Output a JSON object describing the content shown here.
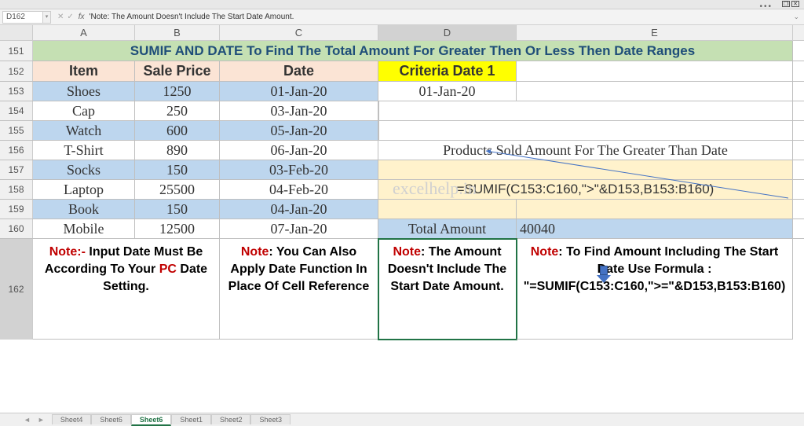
{
  "namebox": "D162",
  "formula_bar": "'Note: The Amount Doesn't Include The Start Date Amount.",
  "columns": [
    "A",
    "B",
    "C",
    "D",
    "E"
  ],
  "title_row": {
    "num": "151",
    "text": "SUMIF AND DATE To Find The Total Amount For Greater Then Or Less Then Date Ranges"
  },
  "header_row": {
    "num": "152",
    "item": "Item",
    "price": "Sale Price",
    "date": "Date",
    "crit": "Criteria Date 1"
  },
  "data_rows": [
    {
      "num": "153",
      "item": "Shoes",
      "price": "1250",
      "date": "01-Jan-20",
      "crit": "01-Jan-20",
      "blue": true
    },
    {
      "num": "154",
      "item": "Cap",
      "price": "250",
      "date": "03-Jan-20",
      "blue": false
    },
    {
      "num": "155",
      "item": "Watch",
      "price": "600",
      "date": "05-Jan-20",
      "blue": true
    },
    {
      "num": "156",
      "item": "T-Shirt",
      "price": "890",
      "date": "06-Jan-20",
      "blue": false,
      "right": "Products Sold Amount For The Greater Than Date"
    },
    {
      "num": "157",
      "item": "Socks",
      "price": "150",
      "date": "03-Feb-20",
      "blue": true
    },
    {
      "num": "158",
      "item": "Laptop",
      "price": "25500",
      "date": "04-Feb-20",
      "blue": false
    },
    {
      "num": "159",
      "item": "Book",
      "price": "150",
      "date": "04-Jan-20",
      "blue": true
    },
    {
      "num": "160",
      "item": "Mobile",
      "price": "12500",
      "date": "07-Jan-20",
      "blue": false
    }
  ],
  "formula_text": "=SUMIF(C153:C160,\">\"&D153,B153:B160)",
  "total_label": "Total Amount",
  "total_value": "40040",
  "notes_row_num": "162",
  "note1": {
    "red": "Note:-",
    "t1": " Input Date Must Be According To Your ",
    "red2": "PC",
    "t2": " Date Setting."
  },
  "note2": {
    "red": "Note",
    "t": ": You Can Also Apply Date Function In Place Of Cell Reference"
  },
  "note3": {
    "red": "Note",
    "t": ": The Amount Doesn't Include The Start Date Amount."
  },
  "note4": {
    "red": "Note",
    "t": ": To Find Amount Including The Start Date Use Formula : \"=SUMIF(C153:C160,\">=\"&D153,B153:B160)"
  },
  "watermark": "excelhelp.in",
  "sheet_tabs": [
    "Sheet4",
    "Sheet6",
    "Sheet6",
    "Sheet1",
    "Sheet2",
    "Sheet3"
  ],
  "active_tab_index": 2,
  "chart_data": {
    "type": "table",
    "columns": [
      "Item",
      "Sale Price",
      "Date"
    ],
    "rows": [
      [
        "Shoes",
        1250,
        "01-Jan-20"
      ],
      [
        "Cap",
        250,
        "03-Jan-20"
      ],
      [
        "Watch",
        600,
        "05-Jan-20"
      ],
      [
        "T-Shirt",
        890,
        "06-Jan-20"
      ],
      [
        "Socks",
        150,
        "03-Feb-20"
      ],
      [
        "Laptop",
        25500,
        "04-Feb-20"
      ],
      [
        "Book",
        150,
        "04-Jan-20"
      ],
      [
        "Mobile",
        12500,
        "07-Jan-20"
      ]
    ],
    "criteria_date": "01-Jan-20",
    "formula": "=SUMIF(C153:C160,\">\"&D153,B153:B160)",
    "result": 40040
  }
}
